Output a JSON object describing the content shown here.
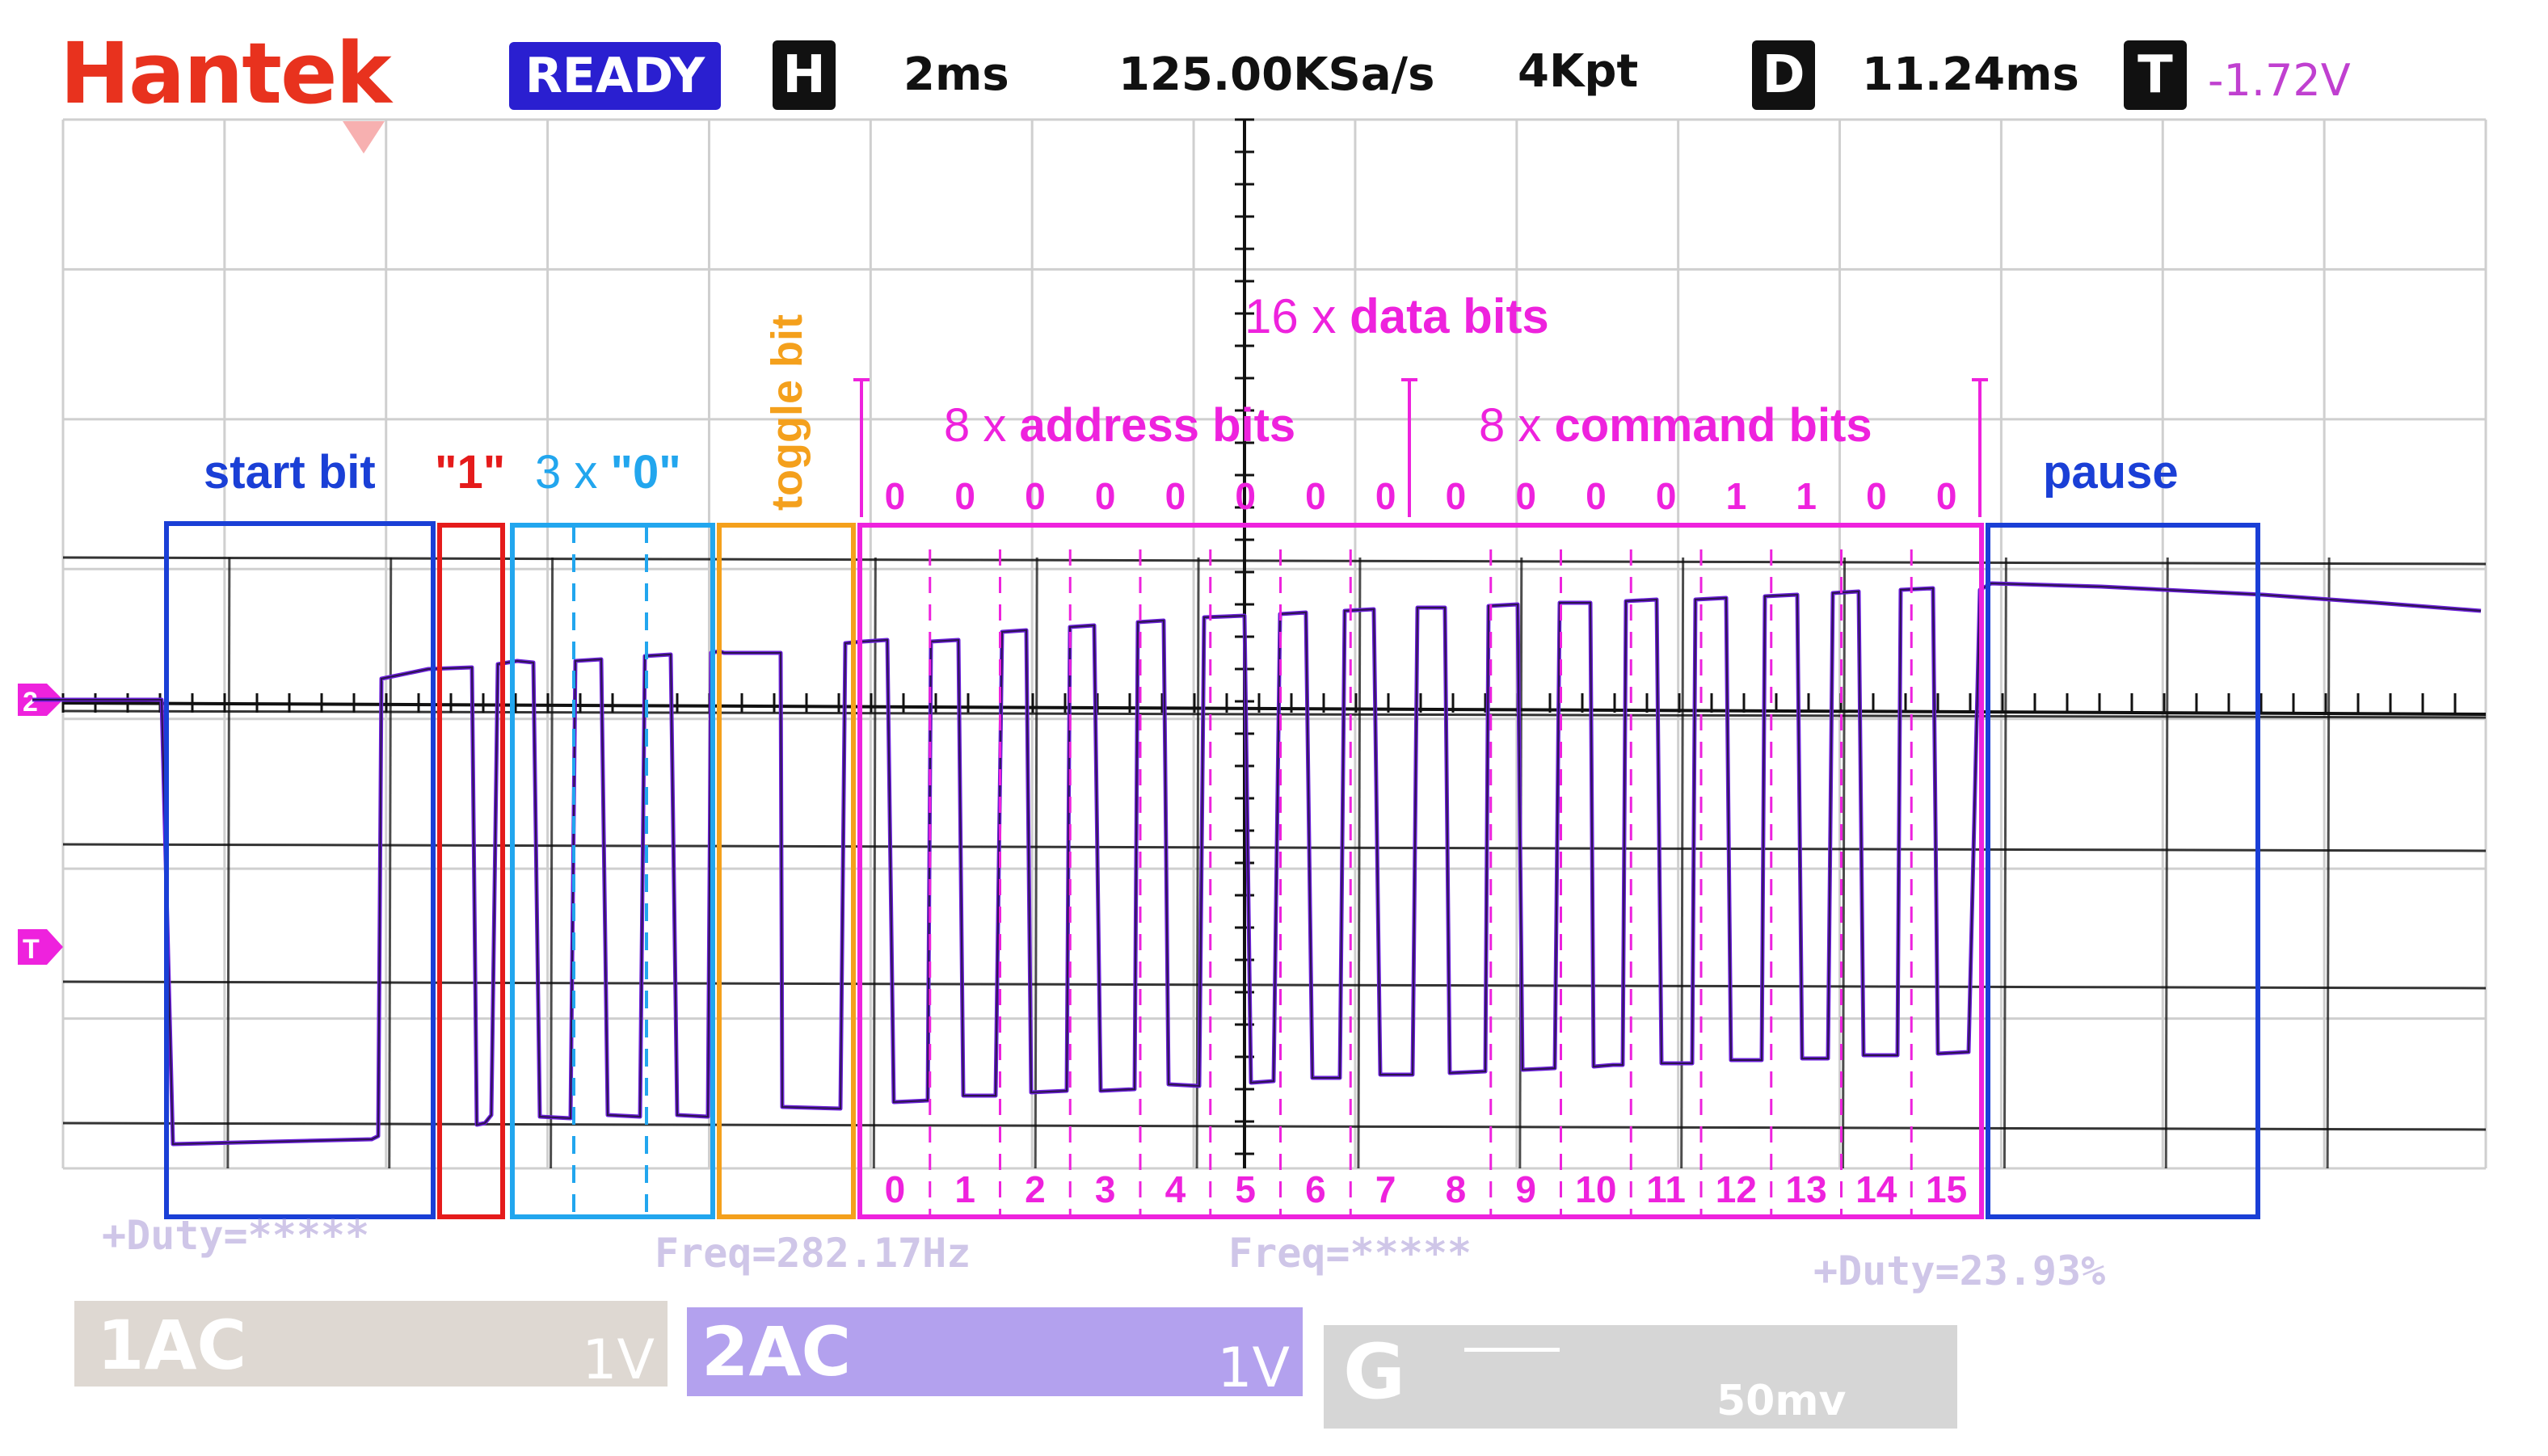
{
  "header": {
    "brand": "Hantek",
    "status": "READY",
    "h_badge": "H",
    "timebase": "2ms",
    "sample_rate": "125.00KSa/s",
    "memory_depth": "4Kpt",
    "d_badge": "D",
    "delay": "11.24ms",
    "t_badge": "T",
    "trigger_level": "-1.72V"
  },
  "annotations": {
    "start_bit": "start bit",
    "one_bit": "\"1\"",
    "zeros_prefix": "3 x ",
    "zeros_value": "\"0\"",
    "toggle_bit": "toggle bit",
    "data_bits_prefix": "16 x ",
    "data_bits_label": "data bits",
    "address_prefix": "8 x ",
    "address_label": "address bits",
    "command_prefix": "8 x ",
    "command_label": "command bits",
    "pause": "pause",
    "bit_values": [
      "0",
      "0",
      "0",
      "0",
      "0",
      "0",
      "0",
      "0",
      "0",
      "0",
      "0",
      "0",
      "1",
      "1",
      "0",
      "0"
    ],
    "bit_indices": [
      "0",
      "1",
      "2",
      "3",
      "4",
      "5",
      "6",
      "7",
      "8",
      "9",
      "10",
      "11",
      "12",
      "13",
      "14",
      "15"
    ]
  },
  "measurements": {
    "duty_ch1": "+Duty=*****",
    "freq_ch2": "Freq=282.17Hz",
    "freq_g": "Freq=*****",
    "duty_g": "+Duty=23.93%"
  },
  "channels": {
    "ch1_label": "1AC",
    "ch1_scale": "1V",
    "ch2_label": "2AC",
    "ch2_scale": "1V",
    "g_label": "G",
    "g_scale": "50mv"
  },
  "markers": {
    "ch2_marker": "2",
    "trigger_marker": "T"
  },
  "colors": {
    "brand": "#e8321e",
    "ready_bg": "#2a1fd0",
    "badge_bg": "#111111",
    "trigger_text": "#c040d0",
    "blue_box": "#1a3fd6",
    "red_box": "#e51b1b",
    "cyan_box": "#22a6ee",
    "orange_box": "#f4a01c",
    "magenta": "#ee22dd",
    "trace": "#6a1fd8",
    "grid": "#cfcfcf",
    "axis": "#111111"
  }
}
